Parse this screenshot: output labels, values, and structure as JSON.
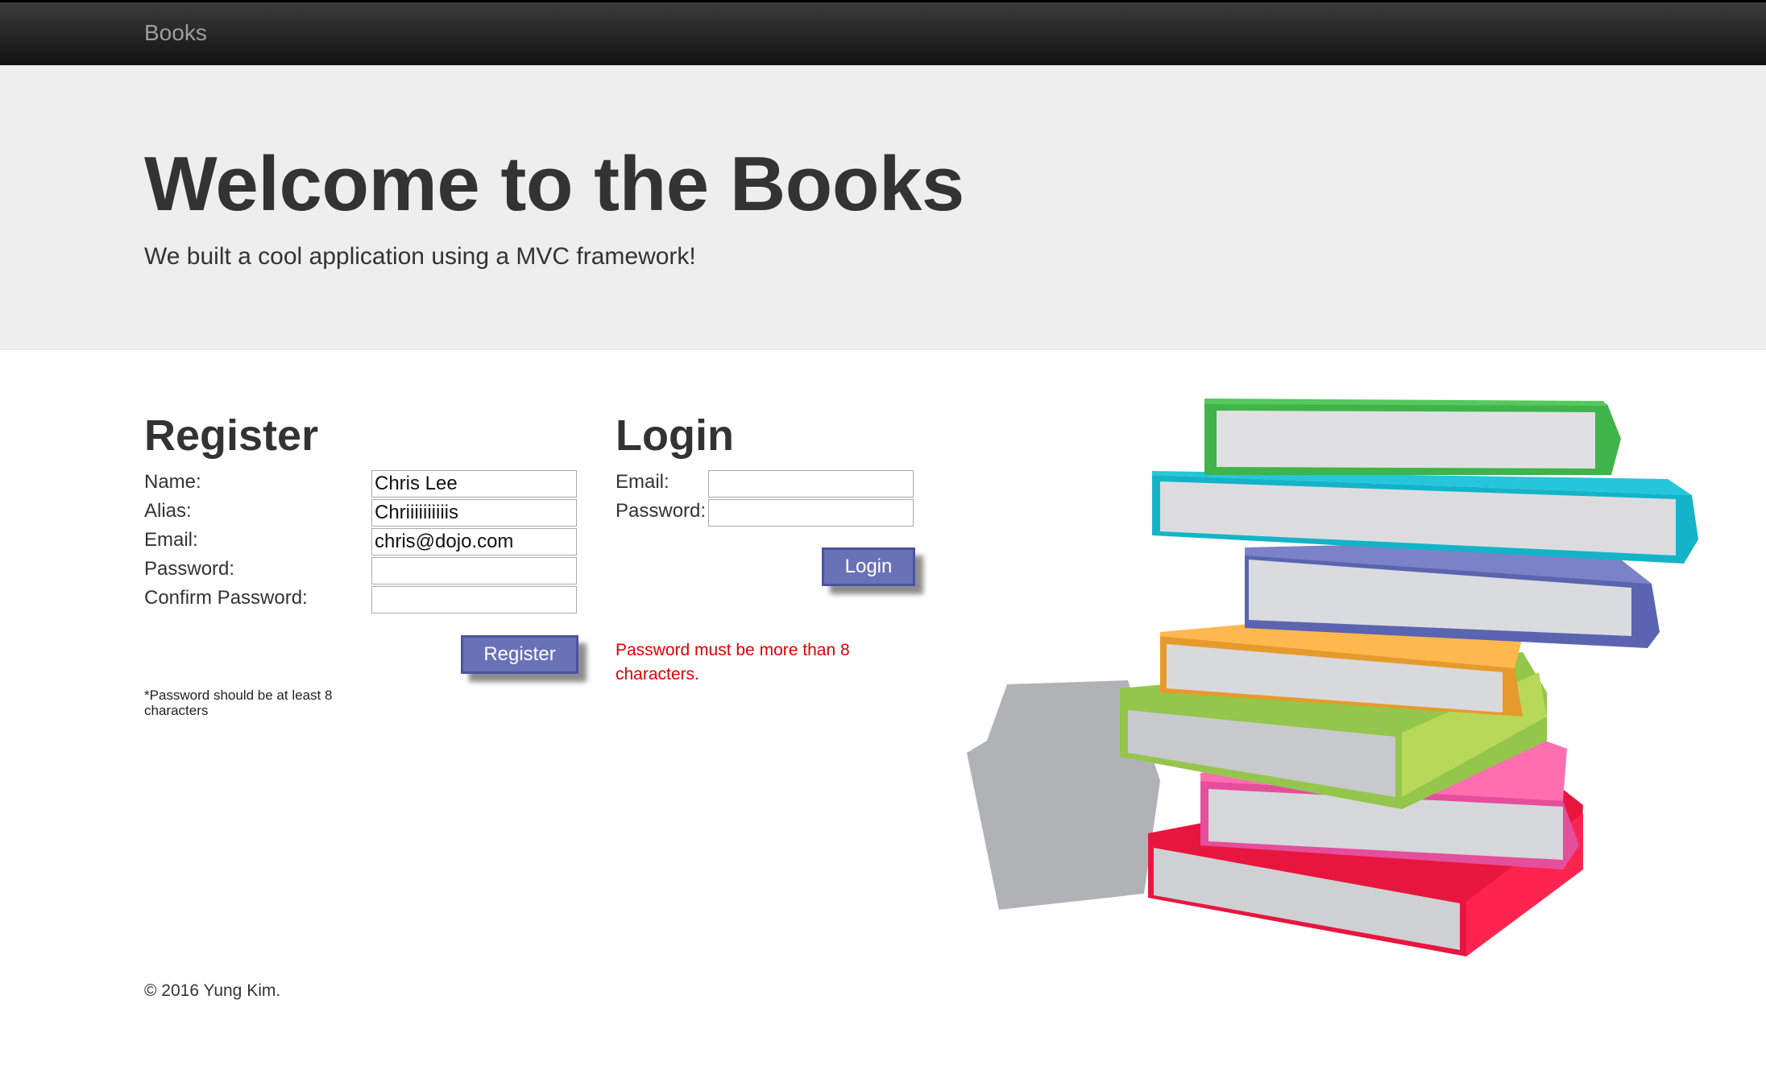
{
  "navbar": {
    "brand": "Books"
  },
  "hero": {
    "title": "Welcome to the Books",
    "subtitle": "We built a cool application using a MVC framework!"
  },
  "register": {
    "title": "Register",
    "labels": {
      "name": "Name:",
      "alias": "Alias:",
      "email": "Email:",
      "password": "Password:",
      "confirm": "Confirm Password:"
    },
    "values": {
      "name": "Chris Lee",
      "alias": "Chriiiiiiiiiis",
      "email": "chris@dojo.com",
      "password": "",
      "confirm": ""
    },
    "button": "Register",
    "note": "*Password should be at least 8 characters"
  },
  "login": {
    "title": "Login",
    "labels": {
      "email": "Email:",
      "password": "Password:"
    },
    "values": {
      "email": "",
      "password": ""
    },
    "button": "Login",
    "error": "Password must be more than 8 characters."
  },
  "footer": {
    "text": "© 2016 Yung Kim."
  },
  "colors": {
    "button": "#6a72b7",
    "error": "#e00000",
    "navbar": "#222222",
    "jumbotron": "#eeeeee"
  },
  "illustration": {
    "icon": "stack-of-books-illustration"
  }
}
